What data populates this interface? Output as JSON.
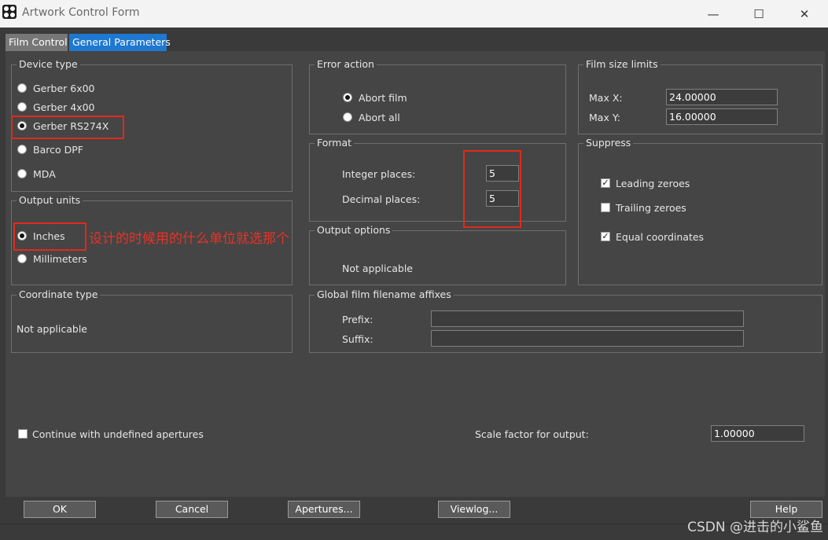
{
  "window": {
    "title": "Artwork Control Form",
    "minimize": "—",
    "maximize": "☐",
    "close": "✕"
  },
  "tabs": [
    {
      "label": "Film Control"
    },
    {
      "label": "General Parameters"
    }
  ],
  "device_type": {
    "title": "Device type",
    "options": [
      {
        "label": "Gerber 6x00",
        "selected": false
      },
      {
        "label": "Gerber 4x00",
        "selected": false
      },
      {
        "label": "Gerber RS274X",
        "selected": true
      },
      {
        "label": "Barco DPF",
        "selected": false
      },
      {
        "label": "MDA",
        "selected": false
      }
    ]
  },
  "output_units": {
    "title": "Output units",
    "options": [
      {
        "label": "Inches",
        "selected": true
      },
      {
        "label": "Millimeters",
        "selected": false
      }
    ]
  },
  "annotation": "设计的时候用的什么单位就选那个",
  "coordinate_type": {
    "title": "Coordinate type",
    "value": "Not applicable"
  },
  "error_action": {
    "title": "Error action",
    "options": [
      {
        "label": "Abort film",
        "selected": true
      },
      {
        "label": "Abort all",
        "selected": false
      }
    ]
  },
  "format": {
    "title": "Format",
    "integer_label": "Integer places:",
    "integer_value": "5",
    "decimal_label": "Decimal places:",
    "decimal_value": "5"
  },
  "output_options": {
    "title": "Output options",
    "value": "Not applicable"
  },
  "film_size_limits": {
    "title": "Film size limits",
    "max_x_label": "Max X:",
    "max_x": "24.00000",
    "max_y_label": "Max Y:",
    "max_y": "16.00000"
  },
  "suppress": {
    "title": "Suppress",
    "options": [
      {
        "label": "Leading zeroes",
        "checked": true
      },
      {
        "label": "Trailing zeroes",
        "checked": false
      },
      {
        "label": "Equal coordinates",
        "checked": true
      }
    ]
  },
  "filename_affixes": {
    "title": "Global film filename affixes",
    "prefix_label": "Prefix:",
    "prefix": "",
    "suffix_label": "Suffix:",
    "suffix": ""
  },
  "continue_undefined": {
    "label": "Continue with undefined apertures",
    "checked": false
  },
  "scale": {
    "label": "Scale factor for output:",
    "value": "1.00000"
  },
  "buttons": {
    "ok": "OK",
    "cancel": "Cancel",
    "apertures": "Apertures...",
    "viewlog": "Viewlog...",
    "help": "Help"
  },
  "watermark": "CSDN @进击的小鲨鱼",
  "colors": {
    "accent_tab": "#1e78d0",
    "annotation_red": "#e02a1c"
  }
}
